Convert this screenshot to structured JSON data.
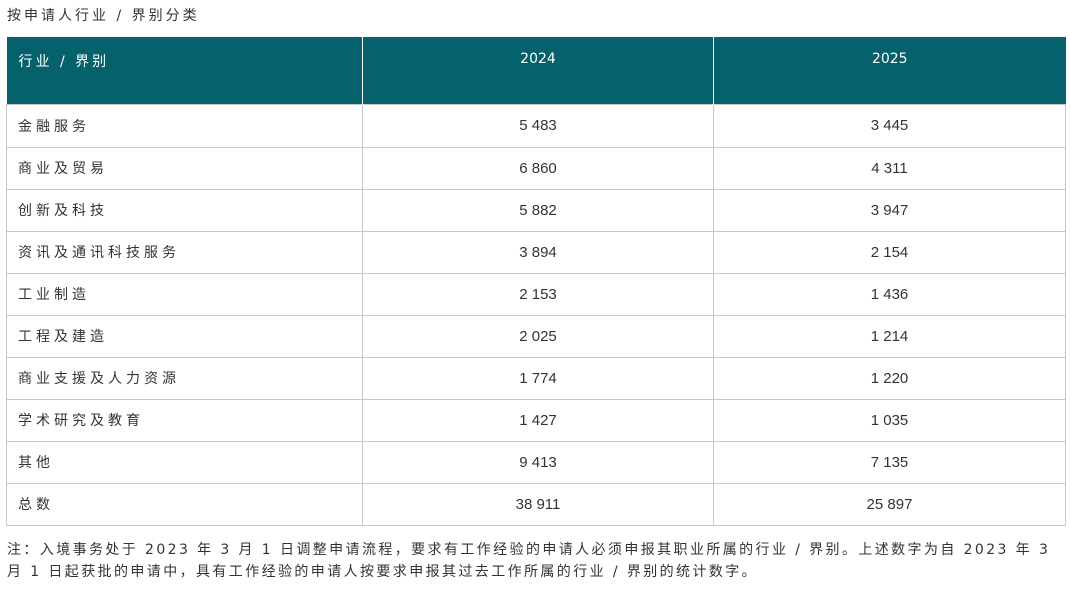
{
  "caption": "按申请人行业 / 界别分类",
  "table": {
    "headers": [
      "行业 / 界别",
      "2024",
      "2025"
    ],
    "rows": [
      {
        "label": "金融服务",
        "v2024": "5 483",
        "v2025": "3 445"
      },
      {
        "label": "商业及贸易",
        "v2024": "6 860",
        "v2025": "4 311"
      },
      {
        "label": "创新及科技",
        "v2024": "5 882",
        "v2025": "3 947"
      },
      {
        "label": "资讯及通讯科技服务",
        "v2024": "3 894",
        "v2025": "2 154"
      },
      {
        "label": "工业制造",
        "v2024": "2 153",
        "v2025": "1 436"
      },
      {
        "label": "工程及建造",
        "v2024": "2 025",
        "v2025": "1 214"
      },
      {
        "label": "商业支援及人力资源",
        "v2024": "1 774",
        "v2025": "1 220"
      },
      {
        "label": "学术研究及教育",
        "v2024": "1 427",
        "v2025": "1 035"
      },
      {
        "label": "其他",
        "v2024": "9 413",
        "v2025": "7 135"
      },
      {
        "label": "总数",
        "v2024": "38 911",
        "v2025": "25 897"
      }
    ]
  },
  "note": "注：入境事务处于 2023 年 3 月 1 日调整申请流程，要求有工作经验的申请人必须申报其职业所属的行业 / 界别。上述数字为自 2023 年 3 月 1 日起获批的申请中，具有工作经验的申请人按要求申报其过去工作所属的行业 / 界别的统计数字。",
  "colors": {
    "header_bg": "#05616b",
    "header_text": "#ffffff",
    "border": "#c8c8c8",
    "text": "#333333"
  }
}
